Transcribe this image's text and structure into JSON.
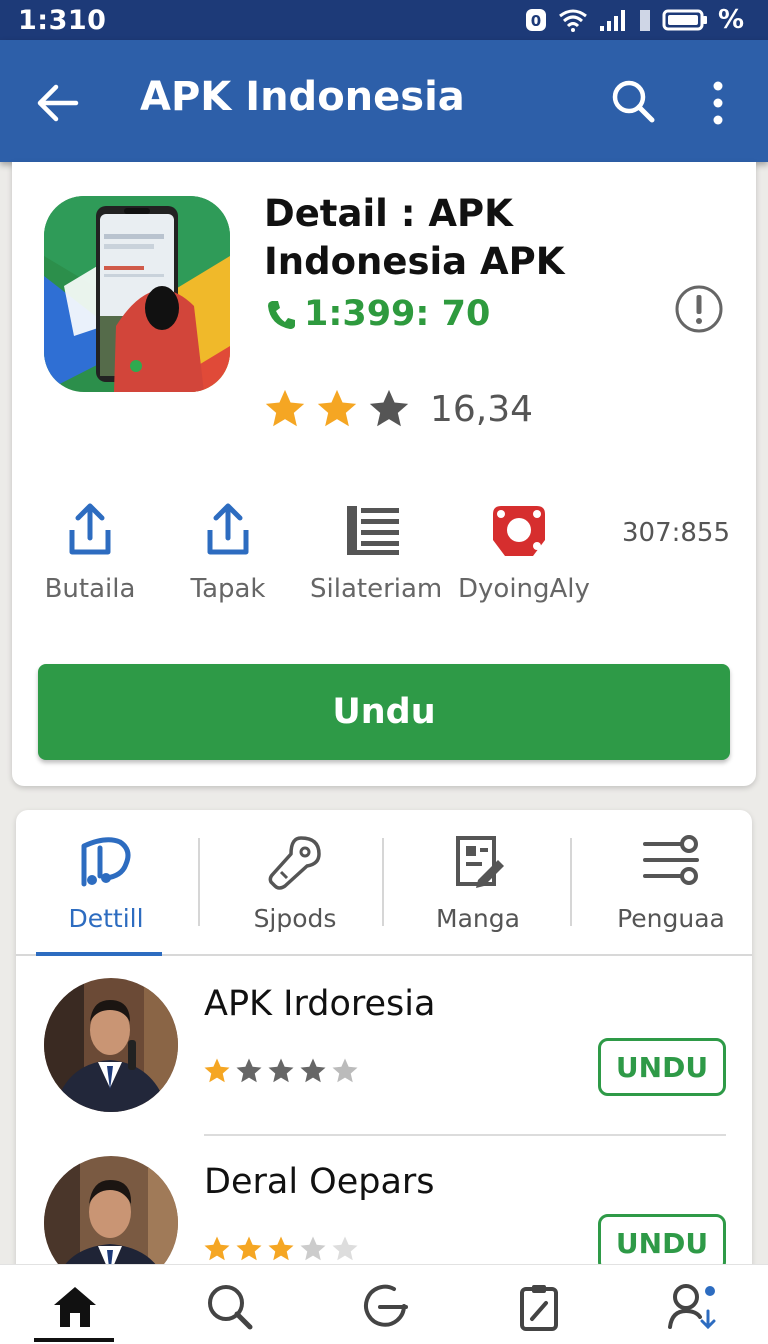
{
  "status_bar": {
    "time": "1:310",
    "battery_pct_label": "%",
    "icons": [
      "notification-badge-icon",
      "wifi-icon",
      "signal-icon",
      "battery-icon"
    ],
    "badge_digit": "0"
  },
  "app_bar": {
    "title": "APK Indonesia",
    "icons": [
      "back-arrow-icon",
      "search-icon",
      "more-vert-icon"
    ]
  },
  "detail": {
    "title": "Detail : APK Indonesia APK",
    "phone": "1:399: 70",
    "rating_value": "16,34",
    "rating_stars": 2,
    "meta": "307:855",
    "actions": [
      {
        "label": "Butaila",
        "icon": "share-icon"
      },
      {
        "label": "Tapak",
        "icon": "share-icon"
      },
      {
        "label": "Silateriam",
        "icon": "list-icon"
      },
      {
        "label": "DyoingAly",
        "icon": "badge-icon"
      }
    ],
    "download_label": "Undu"
  },
  "tabs": [
    {
      "label": "Dettill",
      "icon": "music-note-icon",
      "active": true
    },
    {
      "label": "Sjpods",
      "icon": "key-icon",
      "active": false
    },
    {
      "label": "Manga",
      "icon": "edit-document-icon",
      "active": false
    },
    {
      "label": "Penguaa",
      "icon": "settings-sliders-icon",
      "active": false
    }
  ],
  "list": [
    {
      "title": "APK Irdoresia",
      "rating": 4,
      "button": "UNDU"
    },
    {
      "title": "Deral Oepars",
      "rating": 3,
      "button": "UNDU"
    }
  ],
  "bottom_nav": [
    "home-icon",
    "search-icon",
    "refresh-icon",
    "clipboard-icon",
    "user-search-icon"
  ],
  "colors": {
    "status_bar": "#1d3a78",
    "app_bar": "#2d5fa9",
    "accent_green": "#2e9a47",
    "active_tab": "#2d6cc0",
    "star": "#f5a623"
  }
}
